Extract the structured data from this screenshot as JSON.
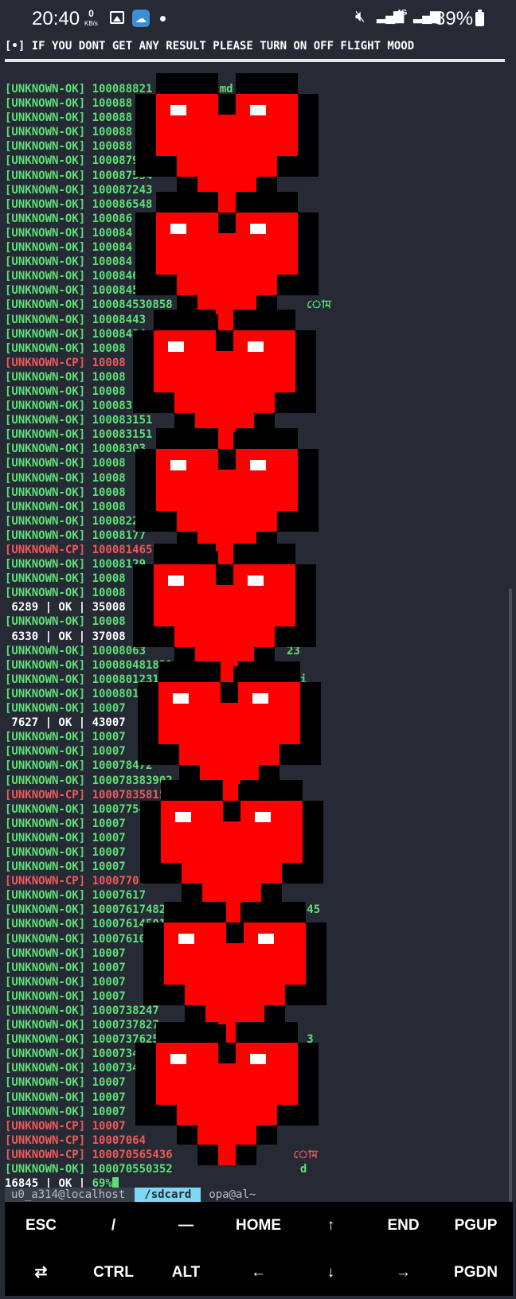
{
  "status_bar": {
    "time": "20:40",
    "data_rate": "0",
    "data_rate_unit": "KB/s",
    "network_type": "4G",
    "battery": "89%"
  },
  "terminal": {
    "notice": "[•] IF YOU DONT GET ANY RESULT PLEASE TURN ON OFF FLIGHT MOOD",
    "lines": [
      {
        "text": "[UNKNOWN-OK] 100088821          md",
        "status": "ok"
      },
      {
        "text": "[UNKNOWN-OK] 100088",
        "status": "ok"
      },
      {
        "text": "[UNKNOWN-OK] 100088",
        "status": "ok"
      },
      {
        "text": "[UNKNOWN-OK] 100088",
        "status": "ok"
      },
      {
        "text": "[UNKNOWN-OK] 100088",
        "status": "ok"
      },
      {
        "text": "[UNKNOWN-OK] 100087937",
        "status": "ok"
      },
      {
        "text": "[UNKNOWN-OK] 100087554",
        "status": "ok"
      },
      {
        "text": "[UNKNOWN-OK] 100087243",
        "status": "ok"
      },
      {
        "text": "[UNKNOWN-OK] 100086548",
        "status": "ok"
      },
      {
        "text": "[UNKNOWN-OK] 100086",
        "status": "ok"
      },
      {
        "text": "[UNKNOWN-OK] 100084",
        "status": "ok"
      },
      {
        "text": "[UNKNOWN-OK] 100084",
        "status": "ok"
      },
      {
        "text": "[UNKNOWN-OK] 100084",
        "status": "ok"
      },
      {
        "text": "[UNKNOWN-OK] 100084661",
        "status": "ok"
      },
      {
        "text": "[UNKNOWN-OK] 100084564",
        "status": "ok"
      },
      {
        "text": "[UNKNOWN-OK] 100084530858                    োম",
        "status": "ok"
      },
      {
        "text": "[UNKNOWN-OK] 10008443",
        "status": "ok"
      },
      {
        "text": "[UNKNOWN-OK] 10008424",
        "status": "ok"
      },
      {
        "text": "[UNKNOWN-OK] 10008",
        "status": "ok"
      },
      {
        "text": "[UNKNOWN-CP] 10008",
        "status": "cp"
      },
      {
        "text": "[UNKNOWN-OK] 10008",
        "status": "ok"
      },
      {
        "text": "[UNKNOWN-OK] 10008",
        "status": "ok"
      },
      {
        "text": "[UNKNOWN-OK] 10008338                      an",
        "status": "ok"
      },
      {
        "text": "[UNKNOWN-OK] 100083151",
        "status": "ok"
      },
      {
        "text": "[UNKNOWN-OK] 100083151",
        "status": "ok"
      },
      {
        "text": "[UNKNOWN-OK] 10008303",
        "status": "ok"
      },
      {
        "text": "[UNKNOWN-OK] 10008",
        "status": "ok"
      },
      {
        "text": "[UNKNOWN-OK] 10008",
        "status": "ok"
      },
      {
        "text": "[UNKNOWN-OK] 10008",
        "status": "ok"
      },
      {
        "text": "[UNKNOWN-OK] 10008",
        "status": "ok"
      },
      {
        "text": "[UNKNOWN-OK] 10008227",
        "status": "ok"
      },
      {
        "text": "[UNKNOWN-OK] 10008177",
        "status": "ok"
      },
      {
        "text": "[UNKNOWN-CP] 100081465721",
        "status": "cp"
      },
      {
        "text": "[UNKNOWN-OK] 10008129",
        "status": "ok"
      },
      {
        "text": "[UNKNOWN-OK] 10008",
        "status": "ok"
      },
      {
        "text": "[UNKNOWN-OK] 10008",
        "status": "ok"
      },
      {
        "text": " 6289 | OK | 35008",
        "status": "plain"
      },
      {
        "text": "[UNKNOWN-OK] 10008",
        "status": "ok"
      },
      {
        "text": " 6330 | OK | 37008",
        "status": "plain"
      },
      {
        "text": "[UNKNOWN-OK] 10008063                     23",
        "status": "ok"
      },
      {
        "text": "[UNKNOWN-OK] 100080481821",
        "status": "ok"
      },
      {
        "text": "[UNKNOWN-OK] 1000801231                    li",
        "status": "ok"
      },
      {
        "text": "[UNKNOWN-OK] 100080111",
        "status": "ok"
      },
      {
        "text": "[UNKNOWN-OK] 10007",
        "status": "ok"
      },
      {
        "text": " 7627 | OK | 43007",
        "status": "plain"
      },
      {
        "text": "[UNKNOWN-OK] 10007",
        "status": "ok"
      },
      {
        "text": "[UNKNOWN-OK] 10007",
        "status": "ok"
      },
      {
        "text": "[UNKNOWN-OK] 100078472",
        "status": "ok"
      },
      {
        "text": "[UNKNOWN-OK] 100078383902",
        "status": "ok"
      },
      {
        "text": "[UNKNOWN-CP] 100078358156",
        "status": "cp"
      },
      {
        "text": "[UNKNOWN-OK] 10007754",
        "status": "ok"
      },
      {
        "text": "[UNKNOWN-OK] 10007",
        "status": "ok"
      },
      {
        "text": "[UNKNOWN-OK] 10007",
        "status": "ok"
      },
      {
        "text": "[UNKNOWN-OK] 10007",
        "status": "ok"
      },
      {
        "text": "[UNKNOWN-OK] 10007",
        "status": "ok"
      },
      {
        "text": "[UNKNOWN-CP] 10007707",
        "status": "cp"
      },
      {
        "text": "[UNKNOWN-OK] 10007617",
        "status": "ok"
      },
      {
        "text": "[UNKNOWN-OK] 1000761748211                  345",
        "status": "ok"
      },
      {
        "text": "[UNKNOWN-OK] 10007614501",
        "status": "ok"
      },
      {
        "text": "[UNKNOWN-OK] 10007610",
        "status": "ok"
      },
      {
        "text": "[UNKNOWN-OK] 10007",
        "status": "ok"
      },
      {
        "text": "[UNKNOWN-OK] 10007",
        "status": "ok"
      },
      {
        "text": "[UNKNOWN-OK] 10007",
        "status": "ok"
      },
      {
        "text": "[UNKNOWN-OK] 10007",
        "status": "ok"
      },
      {
        "text": "[UNKNOWN-OK] 1000738247",
        "status": "ok"
      },
      {
        "text": "[UNKNOWN-OK] 1000737827",
        "status": "ok"
      },
      {
        "text": "[UNKNOWN-OK] 1000737625170                   3",
        "status": "ok"
      },
      {
        "text": "[UNKNOWN-OK] 10007349",
        "status": "ok"
      },
      {
        "text": "[UNKNOWN-OK] 10007349",
        "status": "ok"
      },
      {
        "text": "[UNKNOWN-OK] 10007",
        "status": "ok"
      },
      {
        "text": "[UNKNOWN-OK] 10007",
        "status": "ok"
      },
      {
        "text": "[UNKNOWN-OK] 10007",
        "status": "ok"
      },
      {
        "text": "[UNKNOWN-CP] 10007",
        "status": "cp"
      },
      {
        "text": "[UNKNOWN-CP] 10007064",
        "status": "cp"
      },
      {
        "text": "[UNKNOWN-CP] 100070565436                  োম",
        "status": "cp"
      },
      {
        "text": "[UNKNOWN-OK] 100070550352                   d",
        "status": "ok"
      }
    ],
    "progress": {
      "count": "16845",
      "sep1": " | ",
      "label": "OK",
      "sep2": " | ",
      "percent": "69%"
    },
    "prompt": {
      "user": "u0_a314@localhost",
      "dir": "/sdcard",
      "command": "   opa@al~"
    }
  },
  "extra_keys": [
    {
      "label": "ESC"
    },
    {
      "label": "/"
    },
    {
      "label": "—"
    },
    {
      "label": "HOME"
    },
    {
      "label": "↑"
    },
    {
      "label": "END"
    },
    {
      "label": "PGUP"
    },
    {
      "label": "⇄"
    },
    {
      "label": "CTRL"
    },
    {
      "label": "ALT"
    },
    {
      "label": "←"
    },
    {
      "label": "↓"
    },
    {
      "label": "→"
    },
    {
      "label": "PGDN"
    }
  ],
  "colors": {
    "ok": "#5ee077",
    "cp": "#ef5a5a",
    "heart": "#ff0000",
    "heart_outline": "#000000",
    "background": "#262a35"
  }
}
